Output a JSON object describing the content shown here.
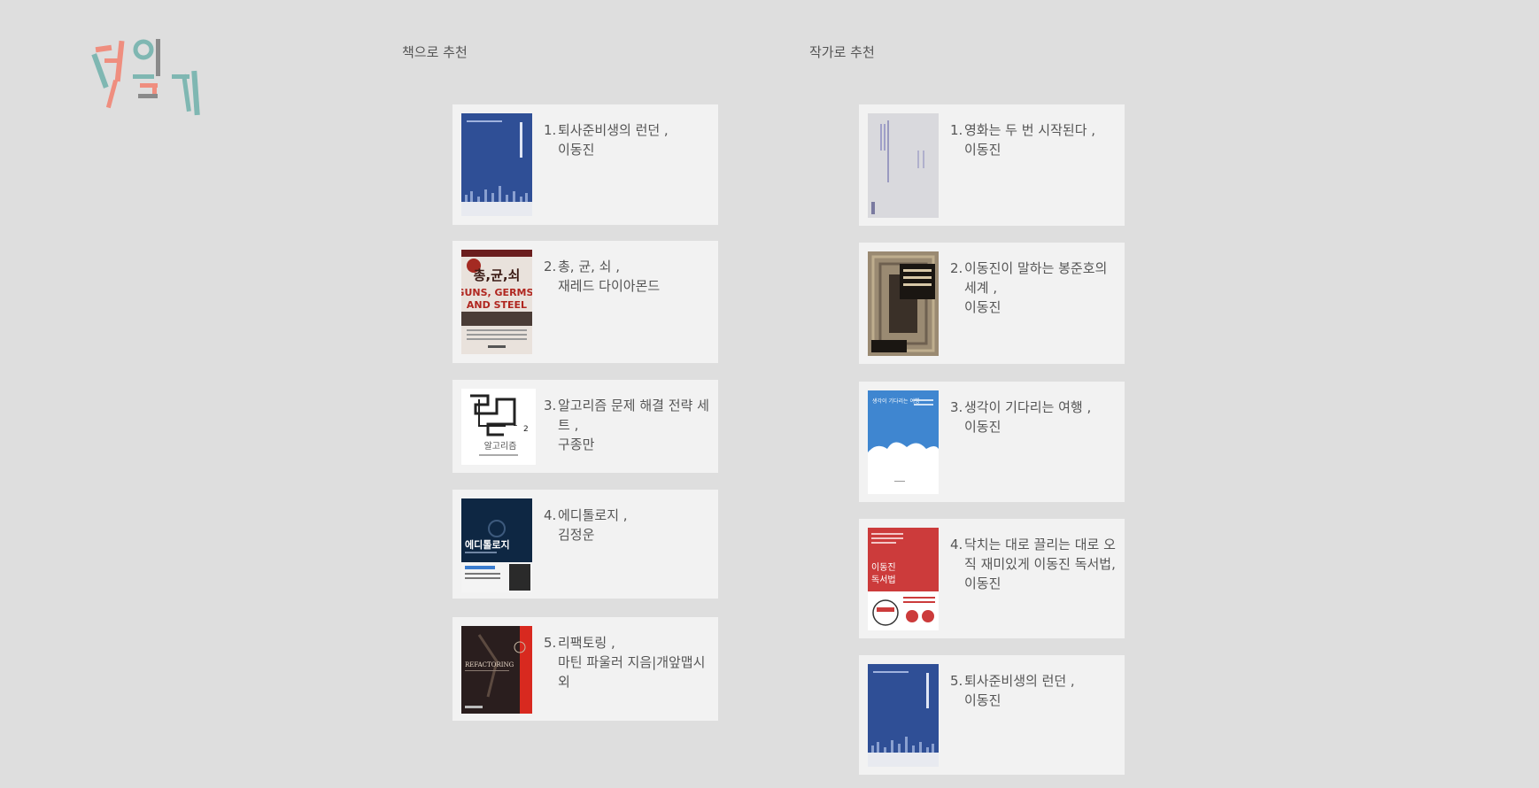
{
  "logo": {
    "text": "책읽기"
  },
  "sections": {
    "books_title": "책으로 추천",
    "authors_title": "작가로 추천"
  },
  "book_recs": [
    {
      "num": "1.",
      "title": "퇴사준비생의 런던 ,",
      "author": "이동진",
      "cover": "blue-city"
    },
    {
      "num": "2.",
      "title": "총, 균, 쇠 ,",
      "author": "재레드 다이아몬드",
      "cover": "guns-germs-steel"
    },
    {
      "num": "3.",
      "title": "알고리즘 문제 해결 전략 세트 ,",
      "author": "구종만",
      "cover": "algorithm-doodle"
    },
    {
      "num": "4.",
      "title": "에디톨로지 ,",
      "author": "김정운",
      "cover": "editology"
    },
    {
      "num": "5.",
      "title": "리팩토링 ,",
      "author": "마틴 파울러 지음|개앞맵시 외",
      "cover": "refactoring"
    }
  ],
  "author_recs": [
    {
      "num": "1.",
      "title": "영화는 두 번 시작된다 ,",
      "author": "이동진",
      "cover": "film-plain"
    },
    {
      "num": "2.",
      "title": "이동진이 말하는 봉준호의 세계 ,",
      "author": "이동진",
      "cover": "bong-world"
    },
    {
      "num": "3.",
      "title": "생각이 기다리는 여행 ,",
      "author": "이동진",
      "cover": "travel-sky"
    },
    {
      "num": "4.",
      "title": "닥치는 대로 끌리는 대로 오직 재미있게 이동진 독서법,",
      "author": "이동진",
      "cover": "reading-red"
    },
    {
      "num": "5.",
      "title": "퇴사준비생의 런던 ,",
      "author": "이동진",
      "cover": "blue-city"
    }
  ],
  "cover_text": {
    "ggs_ko": "총,균,쇠",
    "ggs_en1": "GUNS, GERMS,",
    "ggs_en2": "AND STEEL",
    "algo": "알고리즘",
    "editology": "에디톨로지",
    "refactoring": "REFACTORING",
    "travel": "생각이 기다리는 여행",
    "reading1": "이동진",
    "reading2": "독서법"
  },
  "colors": {
    "background": "#dedede",
    "card": "#f2f2f2",
    "text": "#555555",
    "logo_pink": "#ef8e7f",
    "logo_teal": "#7fb7b2",
    "logo_gray": "#8a8a8a"
  }
}
